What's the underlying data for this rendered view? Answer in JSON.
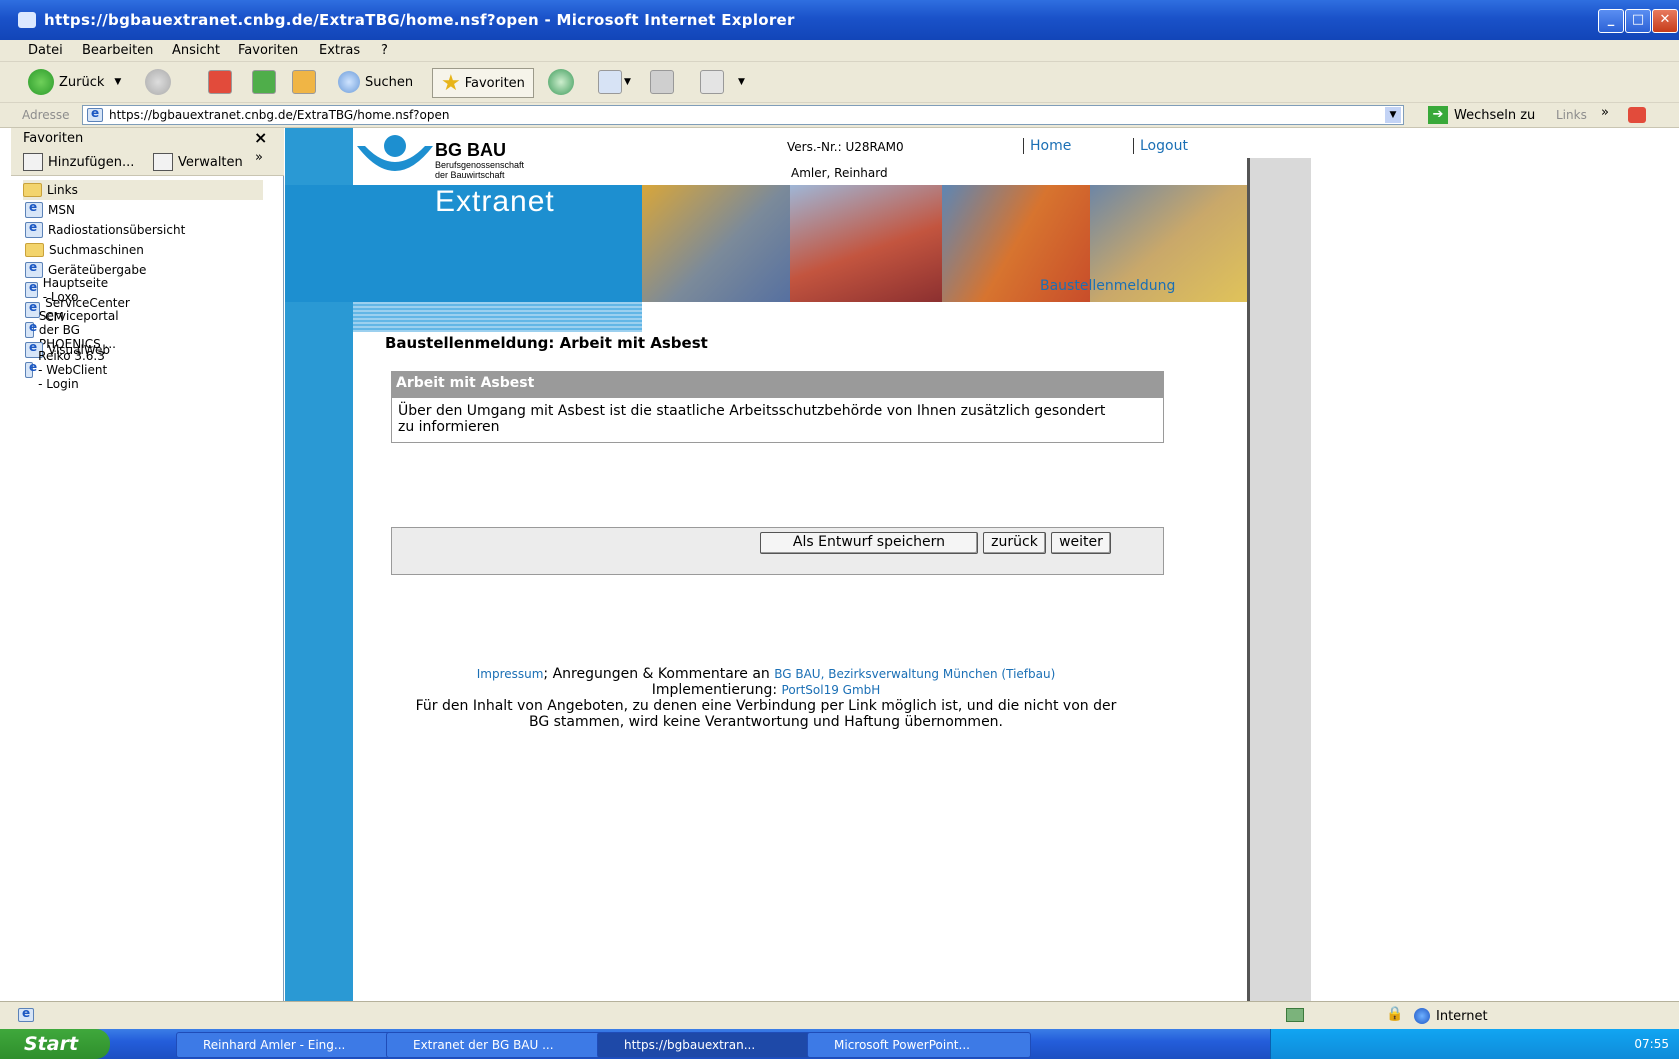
{
  "window": {
    "title": "https://bgbauextranet.cnbg.de/ExtraTBG/home.nsf?open - Microsoft Internet Explorer",
    "controls": [
      "minimize",
      "maximize",
      "close"
    ]
  },
  "menu": [
    "Datei",
    "Bearbeiten",
    "Ansicht",
    "Favoriten",
    "Extras",
    "?"
  ],
  "toolbar": {
    "back": "Zurück",
    "search": "Suchen",
    "favorites": "Favoriten"
  },
  "address": {
    "label": "Adresse",
    "url": "https://bgbauextranet.cnbg.de/ExtraTBG/home.nsf?open",
    "go": "Wechseln zu",
    "links": "Links"
  },
  "favorites_pane": {
    "title": "Favoriten",
    "add": "Hinzufügen...",
    "manage": "Verwalten",
    "items": [
      {
        "label": "Links",
        "icon": "folder-icon"
      },
      {
        "label": "MSN",
        "icon": "ie-page-icon"
      },
      {
        "label": "Radiostationsübersicht",
        "icon": "ie-page-icon"
      },
      {
        "label": "Suchmaschinen",
        "icon": "folder-icon"
      },
      {
        "label": "Geräteübergabe",
        "icon": "ie-page-icon"
      },
      {
        "label": "Hauptseite - Loxo",
        "icon": "ie-page-icon"
      },
      {
        "label": "ServiceCenter CM",
        "icon": "ie-page-icon"
      },
      {
        "label": "Serviceportal der BG PHOENICS ...",
        "icon": "ie-page-icon"
      },
      {
        "label": "VisualWeb",
        "icon": "ie-page-icon"
      },
      {
        "label": "Reiko 3.6.3 - WebClient - Login",
        "icon": "reiko-icon"
      }
    ]
  },
  "page": {
    "logo_title": "BG BAU",
    "logo_sub1": "Berufsgenossenschaft",
    "logo_sub2": "der Bauwirtschaft",
    "version": "Vers.-Nr.: U28RAM0",
    "user": "Amler, Reinhard",
    "nav_home": "Home",
    "nav_logout": "Logout",
    "banner_title": "Extranet",
    "breadcrumb": "Baustellenmeldung",
    "heading": "Baustellenmeldung: Arbeit mit Asbest",
    "box_title": "Arbeit mit Asbest",
    "box_text": "Über den Umgang mit Asbest ist die staatliche Arbeitsschutzbehörde von Ihnen zusätzlich gesondert zu informieren",
    "btn_draft": "Als Entwurf speichern",
    "btn_back": "zurück",
    "btn_next": "weiter",
    "footer_impressum": "Impressum",
    "footer_mid": "; Anregungen & Kommentare an ",
    "footer_bgbau": "BG BAU, Bezirksverwaltung München (Tiefbau)",
    "footer_impl": "Implementierung: ",
    "footer_portsol": "PortSol19 GmbH",
    "footer_disclaimer": "Für den Inhalt von Angeboten, zu denen eine Verbindung per Link möglich ist, und die nicht von der BG stammen, wird keine Verantwortung und Haftung übernommen."
  },
  "status": {
    "zone": "Internet"
  },
  "taskbar": {
    "start": "Start",
    "tasks": [
      "Reinhard Amler - Eing...",
      "Extranet der BG BAU ...",
      "https://bgbauextran...",
      "Microsoft PowerPoint..."
    ],
    "clock": "07:55"
  },
  "colors": {
    "accent_blue": "#2a99d4",
    "link": "#1a6fb5",
    "box_header": "#9a9a9a"
  }
}
